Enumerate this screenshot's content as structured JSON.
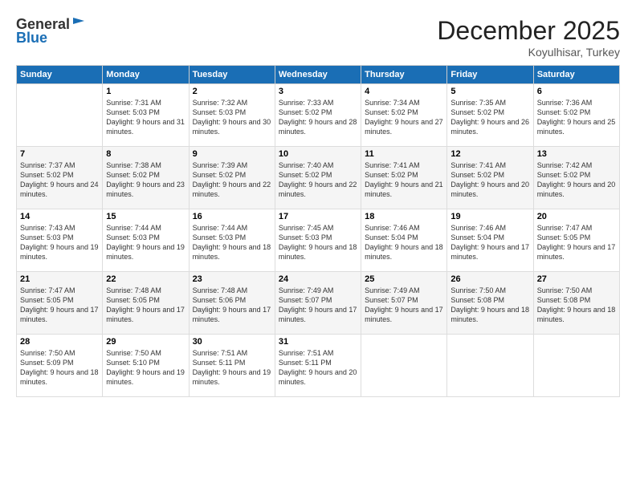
{
  "logo": {
    "line1": "General",
    "line2": "Blue"
  },
  "title": "December 2025",
  "location": "Koyulhisar, Turkey",
  "days_of_week": [
    "Sunday",
    "Monday",
    "Tuesday",
    "Wednesday",
    "Thursday",
    "Friday",
    "Saturday"
  ],
  "weeks": [
    [
      {
        "day": "",
        "sunrise": "",
        "sunset": "",
        "daylight": ""
      },
      {
        "day": "1",
        "sunrise": "Sunrise: 7:31 AM",
        "sunset": "Sunset: 5:03 PM",
        "daylight": "Daylight: 9 hours and 31 minutes."
      },
      {
        "day": "2",
        "sunrise": "Sunrise: 7:32 AM",
        "sunset": "Sunset: 5:03 PM",
        "daylight": "Daylight: 9 hours and 30 minutes."
      },
      {
        "day": "3",
        "sunrise": "Sunrise: 7:33 AM",
        "sunset": "Sunset: 5:02 PM",
        "daylight": "Daylight: 9 hours and 28 minutes."
      },
      {
        "day": "4",
        "sunrise": "Sunrise: 7:34 AM",
        "sunset": "Sunset: 5:02 PM",
        "daylight": "Daylight: 9 hours and 27 minutes."
      },
      {
        "day": "5",
        "sunrise": "Sunrise: 7:35 AM",
        "sunset": "Sunset: 5:02 PM",
        "daylight": "Daylight: 9 hours and 26 minutes."
      },
      {
        "day": "6",
        "sunrise": "Sunrise: 7:36 AM",
        "sunset": "Sunset: 5:02 PM",
        "daylight": "Daylight: 9 hours and 25 minutes."
      }
    ],
    [
      {
        "day": "7",
        "sunrise": "Sunrise: 7:37 AM",
        "sunset": "Sunset: 5:02 PM",
        "daylight": "Daylight: 9 hours and 24 minutes."
      },
      {
        "day": "8",
        "sunrise": "Sunrise: 7:38 AM",
        "sunset": "Sunset: 5:02 PM",
        "daylight": "Daylight: 9 hours and 23 minutes."
      },
      {
        "day": "9",
        "sunrise": "Sunrise: 7:39 AM",
        "sunset": "Sunset: 5:02 PM",
        "daylight": "Daylight: 9 hours and 22 minutes."
      },
      {
        "day": "10",
        "sunrise": "Sunrise: 7:40 AM",
        "sunset": "Sunset: 5:02 PM",
        "daylight": "Daylight: 9 hours and 22 minutes."
      },
      {
        "day": "11",
        "sunrise": "Sunrise: 7:41 AM",
        "sunset": "Sunset: 5:02 PM",
        "daylight": "Daylight: 9 hours and 21 minutes."
      },
      {
        "day": "12",
        "sunrise": "Sunrise: 7:41 AM",
        "sunset": "Sunset: 5:02 PM",
        "daylight": "Daylight: 9 hours and 20 minutes."
      },
      {
        "day": "13",
        "sunrise": "Sunrise: 7:42 AM",
        "sunset": "Sunset: 5:02 PM",
        "daylight": "Daylight: 9 hours and 20 minutes."
      }
    ],
    [
      {
        "day": "14",
        "sunrise": "Sunrise: 7:43 AM",
        "sunset": "Sunset: 5:03 PM",
        "daylight": "Daylight: 9 hours and 19 minutes."
      },
      {
        "day": "15",
        "sunrise": "Sunrise: 7:44 AM",
        "sunset": "Sunset: 5:03 PM",
        "daylight": "Daylight: 9 hours and 19 minutes."
      },
      {
        "day": "16",
        "sunrise": "Sunrise: 7:44 AM",
        "sunset": "Sunset: 5:03 PM",
        "daylight": "Daylight: 9 hours and 18 minutes."
      },
      {
        "day": "17",
        "sunrise": "Sunrise: 7:45 AM",
        "sunset": "Sunset: 5:03 PM",
        "daylight": "Daylight: 9 hours and 18 minutes."
      },
      {
        "day": "18",
        "sunrise": "Sunrise: 7:46 AM",
        "sunset": "Sunset: 5:04 PM",
        "daylight": "Daylight: 9 hours and 18 minutes."
      },
      {
        "day": "19",
        "sunrise": "Sunrise: 7:46 AM",
        "sunset": "Sunset: 5:04 PM",
        "daylight": "Daylight: 9 hours and 17 minutes."
      },
      {
        "day": "20",
        "sunrise": "Sunrise: 7:47 AM",
        "sunset": "Sunset: 5:05 PM",
        "daylight": "Daylight: 9 hours and 17 minutes."
      }
    ],
    [
      {
        "day": "21",
        "sunrise": "Sunrise: 7:47 AM",
        "sunset": "Sunset: 5:05 PM",
        "daylight": "Daylight: 9 hours and 17 minutes."
      },
      {
        "day": "22",
        "sunrise": "Sunrise: 7:48 AM",
        "sunset": "Sunset: 5:05 PM",
        "daylight": "Daylight: 9 hours and 17 minutes."
      },
      {
        "day": "23",
        "sunrise": "Sunrise: 7:48 AM",
        "sunset": "Sunset: 5:06 PM",
        "daylight": "Daylight: 9 hours and 17 minutes."
      },
      {
        "day": "24",
        "sunrise": "Sunrise: 7:49 AM",
        "sunset": "Sunset: 5:07 PM",
        "daylight": "Daylight: 9 hours and 17 minutes."
      },
      {
        "day": "25",
        "sunrise": "Sunrise: 7:49 AM",
        "sunset": "Sunset: 5:07 PM",
        "daylight": "Daylight: 9 hours and 17 minutes."
      },
      {
        "day": "26",
        "sunrise": "Sunrise: 7:50 AM",
        "sunset": "Sunset: 5:08 PM",
        "daylight": "Daylight: 9 hours and 18 minutes."
      },
      {
        "day": "27",
        "sunrise": "Sunrise: 7:50 AM",
        "sunset": "Sunset: 5:08 PM",
        "daylight": "Daylight: 9 hours and 18 minutes."
      }
    ],
    [
      {
        "day": "28",
        "sunrise": "Sunrise: 7:50 AM",
        "sunset": "Sunset: 5:09 PM",
        "daylight": "Daylight: 9 hours and 18 minutes."
      },
      {
        "day": "29",
        "sunrise": "Sunrise: 7:50 AM",
        "sunset": "Sunset: 5:10 PM",
        "daylight": "Daylight: 9 hours and 19 minutes."
      },
      {
        "day": "30",
        "sunrise": "Sunrise: 7:51 AM",
        "sunset": "Sunset: 5:11 PM",
        "daylight": "Daylight: 9 hours and 19 minutes."
      },
      {
        "day": "31",
        "sunrise": "Sunrise: 7:51 AM",
        "sunset": "Sunset: 5:11 PM",
        "daylight": "Daylight: 9 hours and 20 minutes."
      },
      {
        "day": "",
        "sunrise": "",
        "sunset": "",
        "daylight": ""
      },
      {
        "day": "",
        "sunrise": "",
        "sunset": "",
        "daylight": ""
      },
      {
        "day": "",
        "sunrise": "",
        "sunset": "",
        "daylight": ""
      }
    ]
  ]
}
